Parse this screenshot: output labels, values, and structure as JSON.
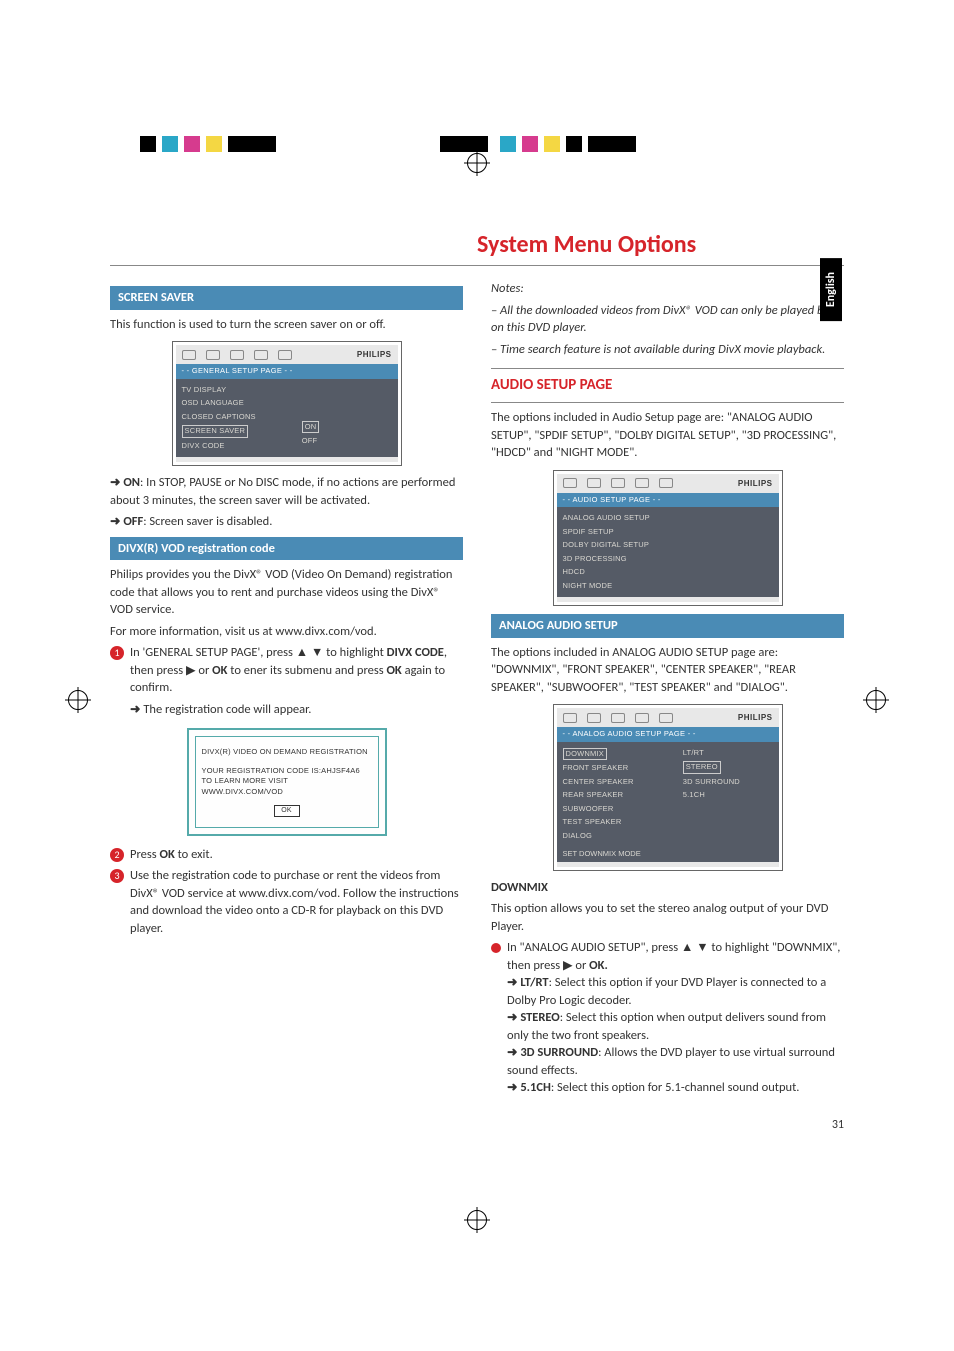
{
  "language_tab": "English",
  "page_title": "System Menu Options",
  "page_number": "31",
  "left": {
    "screen_saver_heading": "SCREEN SAVER",
    "screen_saver_desc": "This function is used to turn the screen saver on or off.",
    "menu1": {
      "brand": "PHILIPS",
      "title": "- - GENERAL SETUP PAGE - -",
      "items_left": [
        "TV DISPLAY",
        "OSD LANGUAGE",
        "CLOSED CAPTIONS",
        "SCREEN SAVER",
        "DIVX CODE"
      ],
      "items_right": [
        "ON",
        "OFF"
      ],
      "selected_left_index": 3,
      "boxed_right_index": 0
    },
    "ss_on_label": "ON",
    "ss_on_text": ": In STOP, PAUSE or No DISC mode, if no actions are performed about 3 minutes, the screen saver will be activated.",
    "ss_off_label": "OFF",
    "ss_off_text": ": Screen saver is disabled.",
    "divx_heading": "DIVX(R) VOD registration code",
    "divx_p1": "Philips provides you the DivX® VOD (Video On Demand) registration code that allows you to rent and purchase videos using the DivX® VOD service.",
    "divx_p2": "For more information, visit us at www.divx.com/vod.",
    "step1_a": "In 'GENERAL SETUP PAGE', press ▲ ▼ to highlight ",
    "step1_bold": "DIVX CODE",
    "step1_b": ", then press ▶ or ",
    "step1_ok": "OK",
    "step1_c": " to ener its submenu and press ",
    "step1_ok2": "OK",
    "step1_d": " again to confirm.",
    "step1_result": "The registration code will appear.",
    "divx_box": {
      "line1": "DIVX(R) VIDEO ON DEMAND REGISTRATION",
      "line2": "YOUR REGISTRATION CODE IS:AHJSF4A6",
      "line3": "TO LEARN MORE VISIT WWW.DIVX.COM/VOD",
      "ok": "OK"
    },
    "step2_a": "Press ",
    "step2_ok": "OK",
    "step2_b": " to exit.",
    "step3": "Use the registration code to purchase or rent the videos from DivX® VOD service at www.divx.com/vod. Follow the instructions and download the video onto a CD-R for playback on this DVD player."
  },
  "right": {
    "notes_label": "Notes:",
    "note1": "–   All the downloaded videos from DivX® VOD can only be played back on this DVD player.",
    "note2": "–   Time search feature is not available during DivX movie playback.",
    "audio_setup_heading": "AUDIO SETUP PAGE",
    "audio_setup_desc": "The options included in Audio Setup page are: \"ANALOG AUDIO SETUP\", \"SPDIF SETUP\", \"DOLBY DIGITAL SETUP\", \"3D PROCESSING\", \"HDCD\" and \"NIGHT MODE\".",
    "menu2": {
      "brand": "PHILIPS",
      "title": "- - AUDIO SETUP PAGE - -",
      "items_left": [
        "ANALOG AUDIO SETUP",
        "SPDIF SETUP",
        "DOLBY DIGITAL SETUP",
        "3D PROCESSING",
        "HDCD",
        "NIGHT MODE"
      ]
    },
    "analog_heading": "ANALOG AUDIO SETUP",
    "analog_desc": "The options included in ANALOG AUDIO SETUP page are: \"DOWNMIX\", \"FRONT SPEAKER\", \"CENTER SPEAKER\", \"REAR SPEAKER\", \"SUBWOOFER\", \"TEST SPEAKER\" and \"DIALOG\".",
    "menu3": {
      "brand": "PHILIPS",
      "title": "- - ANALOG AUDIO SETUP PAGE - -",
      "items_left": [
        "DOWNMIX",
        "FRONT SPEAKER",
        "CENTER SPEAKER",
        "REAR SPEAKER",
        "SUBWOOFER",
        "TEST SPEAKER",
        "DIALOG"
      ],
      "items_right": [
        "LT/RT",
        "STEREO",
        "3D SURROUND",
        "5.1CH"
      ],
      "selected_left_index": 0,
      "boxed_right_index": 1,
      "footer_line": "SET DOWNMIX MODE"
    },
    "downmix_heading": "DOWNMIX",
    "downmix_desc": "This option allows you to set the stereo analog output of your DVD Player.",
    "dm_intro_a": "In \"ANALOG AUDIO SETUP\", press ▲ ▼ to highlight \"DOWNMIX\", then press ▶ or ",
    "dm_intro_ok": "OK.",
    "dm_ltrt_label": "LT/RT",
    "dm_ltrt_text": ": Select this option if your DVD Player is connected to a Dolby Pro Logic decoder.",
    "dm_stereo_label": "STEREO",
    "dm_stereo_text": ": Select this option when output delivers sound from only the two front speakers.",
    "dm_3d_label": "3D SURROUND",
    "dm_3d_text": ": Allows the DVD player to use virtual surround sound effects.",
    "dm_51_label": "5.1CH",
    "dm_51_text": ": Select this option for 5.1-channel sound output."
  },
  "chart_data": null
}
